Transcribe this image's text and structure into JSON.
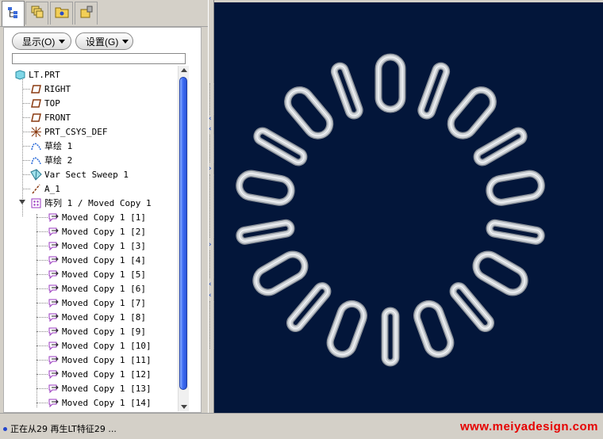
{
  "tabs": [
    {
      "name": "model-tree-icon",
      "active": true
    },
    {
      "name": "layers-icon",
      "active": false
    },
    {
      "name": "folder-browser-icon",
      "active": false
    },
    {
      "name": "favorites-icon",
      "active": false
    }
  ],
  "toolbar": {
    "show_label": "显示(O)",
    "settings_label": "设置(G)"
  },
  "tree": {
    "root": "LT.PRT",
    "items": [
      {
        "label": "RIGHT",
        "icon": "datum-plane-icon"
      },
      {
        "label": "TOP",
        "icon": "datum-plane-icon"
      },
      {
        "label": "FRONT",
        "icon": "datum-plane-icon"
      },
      {
        "label": "PRT_CSYS_DEF",
        "icon": "coordinate-system-icon"
      },
      {
        "label": "草绘 1",
        "icon": "sketch-icon"
      },
      {
        "label": "草绘 2",
        "icon": "sketch-icon"
      },
      {
        "label": "Var Sect Sweep 1",
        "icon": "sweep-feature-icon"
      },
      {
        "label": "A_1",
        "icon": "datum-axis-icon"
      }
    ],
    "pattern": {
      "label": "阵列 1 / Moved Copy 1",
      "icon": "pattern-icon"
    },
    "children": [
      "Moved Copy 1 [1]",
      "Moved Copy 1 [2]",
      "Moved Copy 1 [3]",
      "Moved Copy 1 [4]",
      "Moved Copy 1 [5]",
      "Moved Copy 1 [6]",
      "Moved Copy 1 [7]",
      "Moved Copy 1 [8]",
      "Moved Copy 1 [9]",
      "Moved Copy 1 [10]",
      "Moved Copy 1 [11]",
      "Moved Copy 1 [12]",
      "Moved Copy 1 [13]",
      "Moved Copy 1 [14]"
    ]
  },
  "viewport": {
    "background": "#03163a",
    "model": "chain-ring",
    "link_count": 18,
    "link_color": "#cfd3d8"
  },
  "status": {
    "message": "正在从29 再生LT特征29 ...",
    "message2": "正在从29 再..."
  },
  "watermark": "www.meiyadesign.com",
  "colors": {
    "accent": "#3d6cf4",
    "watermark": "#e60000"
  }
}
